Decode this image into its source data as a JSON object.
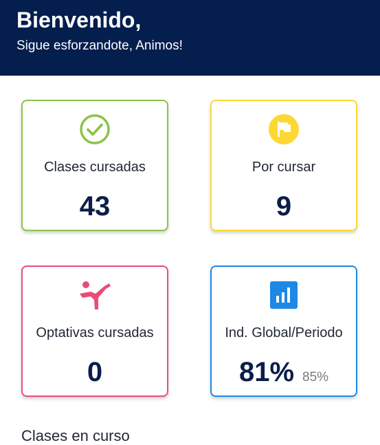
{
  "header": {
    "title": "Bienvenido,",
    "subtitle": "Sigue esforzandote, Animos!"
  },
  "cards": [
    {
      "label": "Clases cursadas",
      "value": "43",
      "icon": "check-circle-icon",
      "color": "#8bc34a"
    },
    {
      "label": "Por cursar",
      "value": "9",
      "icon": "flag-icon",
      "color": "#fdd835"
    },
    {
      "label": "Optativas cursadas",
      "value": "0",
      "icon": "karate-kick-icon",
      "color": "#e94d77"
    },
    {
      "label": "Ind. Global/Periodo",
      "value": "81%",
      "secondary_value": "85%",
      "icon": "bar-chart-icon",
      "color": "#1e88e5"
    }
  ],
  "section": {
    "title": "Clases en curso"
  }
}
